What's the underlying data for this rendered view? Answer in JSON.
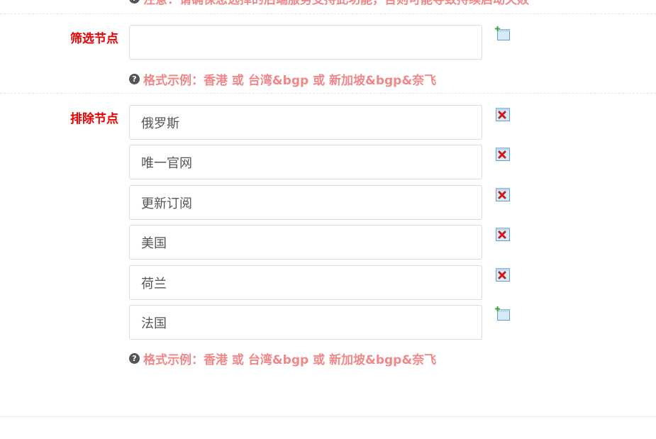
{
  "top_note": {
    "text": "注意：请确保您选择的后端服务支持此功能，否则可能导致持续启动失败"
  },
  "filter_nodes": {
    "label": "筛选节点",
    "value": "",
    "hint_icon": "question-circle-icon",
    "hint": "格式示例：香港 或 台湾&bgp 或 新加坡&bgp&奈飞",
    "add_icon": "add-icon"
  },
  "exclude_nodes": {
    "label": "排除节点",
    "items": [
      {
        "value": "俄罗斯",
        "action_icon": "remove-icon"
      },
      {
        "value": "唯一官网",
        "action_icon": "remove-icon"
      },
      {
        "value": "更新订阅",
        "action_icon": "remove-icon"
      },
      {
        "value": "美国",
        "action_icon": "remove-icon"
      },
      {
        "value": "荷兰",
        "action_icon": "remove-icon"
      },
      {
        "value": "法国",
        "action_icon": "add-icon"
      }
    ],
    "hint_icon": "question-circle-icon",
    "hint": "格式示例：香港 或 台湾&bgp 或 新加坡&bgp&奈飞"
  },
  "colors": {
    "label": "#e60000",
    "hint": "#f0888a",
    "border": "#dcdcdc"
  }
}
